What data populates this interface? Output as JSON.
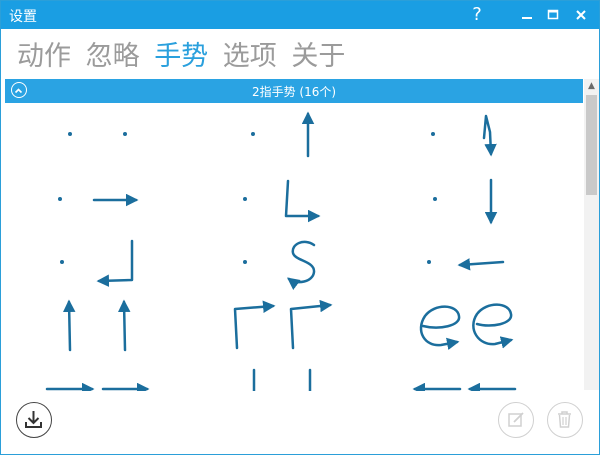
{
  "window": {
    "title": "设置"
  },
  "titlebar": {
    "help": "?",
    "minimize": "−",
    "maximize": "▫",
    "close": "✕"
  },
  "nav": {
    "tabs": [
      "动作",
      "忽略",
      "手势",
      "选项",
      "关于"
    ],
    "active": "手势"
  },
  "section": {
    "title": "2指手势 (16个)",
    "collapse_icon": "chevron-up-icon"
  },
  "gestures": {
    "count_visible": 15,
    "items": [
      "two-dot",
      "vertical-arrow-up",
      "dot-hook",
      "dot-arrow-right",
      "l-shape",
      "dot-vertical-down",
      "dot-j-hook",
      "s-shape",
      "dot-arrow-left",
      "two-arrows-up",
      "two-corners-right",
      "two-e-loops",
      "two-arrows-right",
      "two-verticals",
      "two-arrows-left"
    ]
  },
  "colors": {
    "accent": "#1a9ee3",
    "gesture_ink": "#1b6e9d",
    "inactive_tab": "#9b9b9b"
  },
  "bottom": {
    "download_icon": "download-icon",
    "edit_icon": "edit-icon",
    "trash_icon": "trash-icon"
  }
}
